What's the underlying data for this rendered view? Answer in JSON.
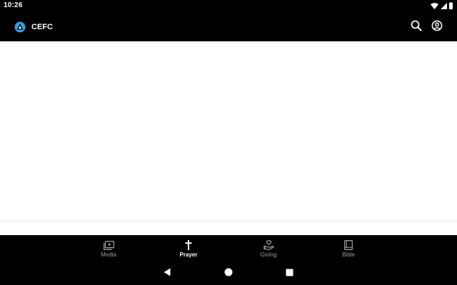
{
  "status_bar": {
    "time": "10:26",
    "icons": [
      "wifi-icon",
      "cellular-signal-icon",
      "battery-icon"
    ]
  },
  "app_bar": {
    "logo_icon": "cefc-logo-icon",
    "title": "CEFC",
    "actions": [
      {
        "name": "search",
        "icon": "search-icon"
      },
      {
        "name": "account",
        "icon": "account-circle-icon"
      }
    ]
  },
  "bottom_nav": {
    "items": [
      {
        "label": "Media",
        "icon": "video-library-icon",
        "active": false
      },
      {
        "label": "Prayer",
        "icon": "cross-icon",
        "active": true
      },
      {
        "label": "Giving",
        "icon": "hand-heart-icon",
        "active": false
      },
      {
        "label": "Bible",
        "icon": "book-icon",
        "active": false
      }
    ]
  },
  "system_nav": {
    "buttons": [
      "back-icon",
      "home-icon",
      "recents-icon"
    ]
  },
  "colors": {
    "background": "#000000",
    "content": "#ffffff",
    "active_label": "#ffffff",
    "inactive_label": "#9a9a9a",
    "logo_blue": "#2f9fe0"
  }
}
